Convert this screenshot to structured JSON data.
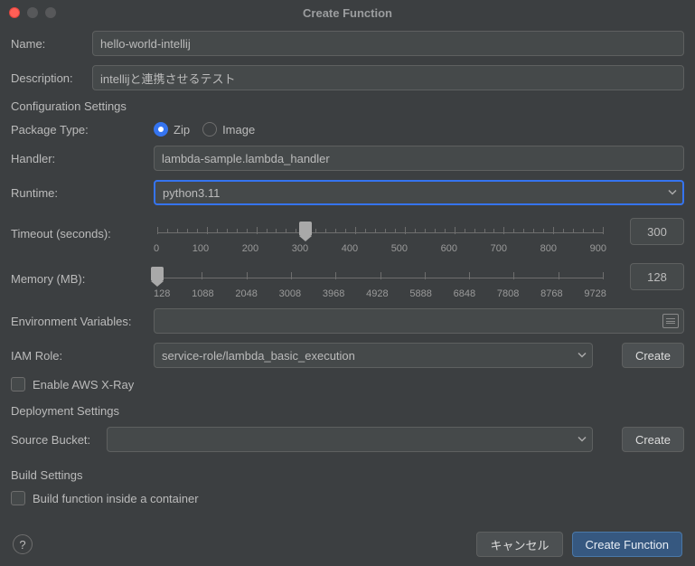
{
  "title": "Create Function",
  "labels": {
    "name": "Name:",
    "description": "Description:",
    "config_settings": "Configuration Settings",
    "package_type": "Package Type:",
    "handler": "Handler:",
    "runtime": "Runtime:",
    "timeout": "Timeout (seconds):",
    "memory": "Memory (MB):",
    "env": "Environment Variables:",
    "iam": "IAM Role:",
    "xray": "Enable AWS X-Ray",
    "deploy_settings": "Deployment Settings",
    "source_bucket": "Source Bucket:",
    "build_settings": "Build Settings",
    "build_container": "Build function inside a container"
  },
  "values": {
    "name": "hello-world-intellij",
    "description": "intellijと連携させるテスト",
    "handler": "lambda-sample.lambda_handler",
    "runtime": "python3.11",
    "timeout": "300",
    "memory": "128",
    "iam_role": "service-role/lambda_basic_execution",
    "source_bucket": ""
  },
  "package_type": {
    "zip": "Zip",
    "image": "Image",
    "selected": "zip"
  },
  "timeout_ticks": [
    "0",
    "100",
    "200",
    "300",
    "400",
    "500",
    "600",
    "700",
    "800",
    "900"
  ],
  "memory_ticks": [
    "128",
    "1088",
    "2048",
    "3008",
    "3968",
    "4928",
    "5888",
    "6848",
    "7808",
    "8768",
    "9728"
  ],
  "buttons": {
    "create": "Create",
    "cancel": "キャンセル",
    "create_function": "Create Function"
  }
}
